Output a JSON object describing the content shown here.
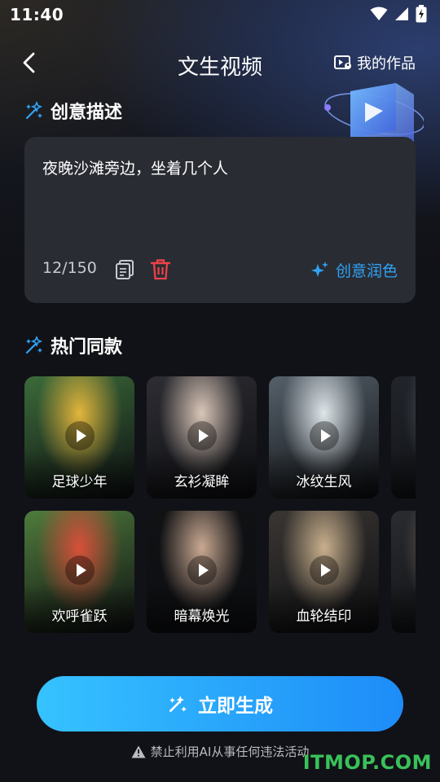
{
  "status_bar": {
    "time": "11:40"
  },
  "header": {
    "title": "文生视频",
    "my_works_label": "我的作品"
  },
  "description_section": {
    "title": "创意描述",
    "text": "夜晚沙滩旁边，坐着几个人",
    "char_count": "12/150",
    "polish_label": "创意润色"
  },
  "templates_section": {
    "title": "热门同款",
    "items": [
      {
        "label": "足球少年",
        "bg": "#3b6b3a",
        "accent": "#e2b53c"
      },
      {
        "label": "玄衫凝眸",
        "bg": "#2d2d33",
        "accent": "#d9c6b8"
      },
      {
        "label": "冰纹生风",
        "bg": "#55606a",
        "accent": "#dfe6ea"
      },
      {
        "label": "",
        "bg": "#22262c",
        "accent": "#5b626b"
      },
      {
        "label": "欢呼雀跃",
        "bg": "#4f7c3c",
        "accent": "#d94f3a"
      },
      {
        "label": "暗幕焕光",
        "bg": "#101214",
        "accent": "#caa992"
      },
      {
        "label": "血轮结印",
        "bg": "#3a3633",
        "accent": "#c9b08d"
      },
      {
        "label": "",
        "bg": "#2a2c30",
        "accent": "#7a6b61"
      }
    ]
  },
  "generate_button": {
    "label": "立即生成"
  },
  "disclaimer": "禁止利用AI从事任何违法活动",
  "watermark": "ITMOP.COM",
  "colors": {
    "accent": "#2fa4f7",
    "danger": "#f0424a",
    "watermark": "#39c15a"
  }
}
